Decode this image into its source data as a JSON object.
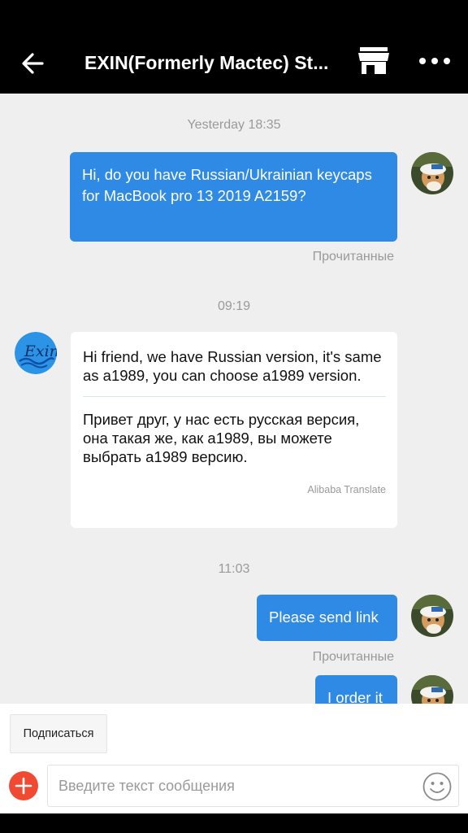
{
  "header": {
    "title": "EXIN(Formerly Mactec) St..."
  },
  "messages": [
    {
      "time": "Yesterday 18:35"
    },
    {
      "text": "Hi, do you have Russian/Ukrainian keycaps for MacBook pro 13 2019 A2159?",
      "status": "Прочитанные"
    },
    {
      "time": "09:19"
    },
    {
      "text": "Hi friend, we have Russian version, it's same as a1989,  you can choose a1989 version.",
      "translation": "Привет друг, у нас есть русская версия, она такая же, как а1989, вы можете выбрать а1989 версию.",
      "translation_source": "Alibaba Translate"
    },
    {
      "time": "11:03"
    },
    {
      "text": "Please send link",
      "status": "Прочитанные"
    },
    {
      "text": "I order it"
    }
  ],
  "seller_logo_text": "Exin",
  "bottom": {
    "subscribe_label": "Подписаться",
    "input_placeholder": "Введите текст сообщения"
  },
  "colors": {
    "header_bg": "#000000",
    "outgoing_bubble": "#2f8ae5",
    "add_button": "#f04b32",
    "chat_bg": "#efefef"
  },
  "icons": [
    "back-arrow-icon",
    "store-icon",
    "more-icon",
    "plus-icon",
    "emoji-icon"
  ]
}
